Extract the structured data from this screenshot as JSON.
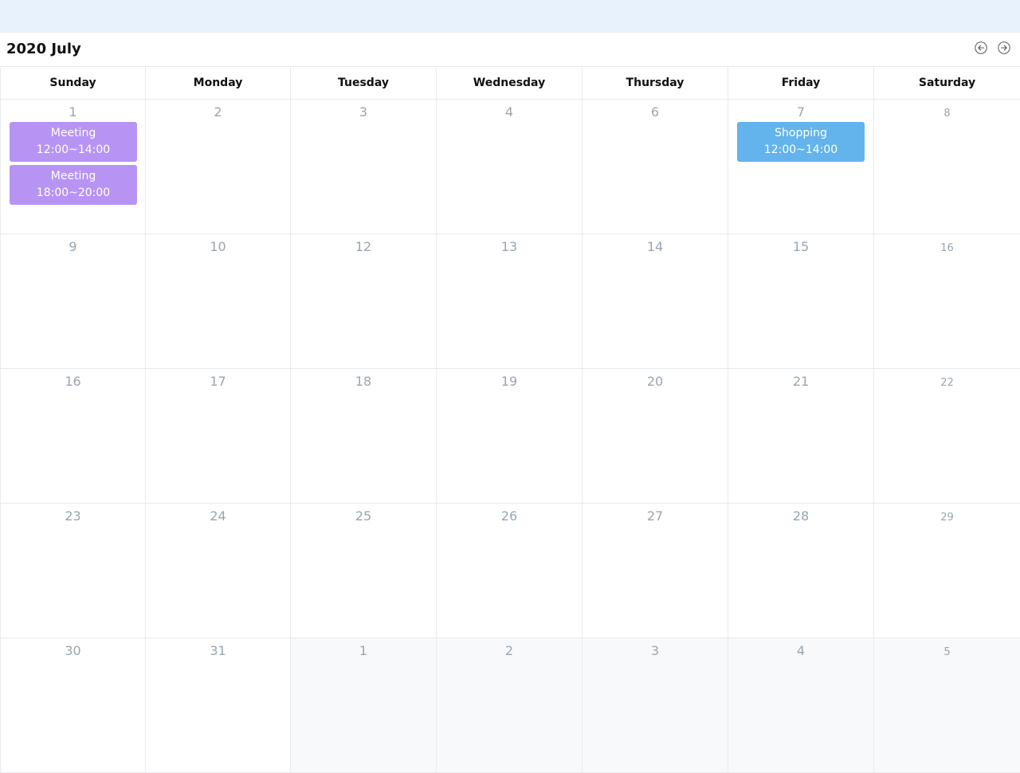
{
  "calendar": {
    "title": "2020 July",
    "prev_icon": "arrow-left-circle-icon",
    "next_icon": "arrow-right-circle-icon",
    "weekdays": [
      "Sunday",
      "Monday",
      "Tuesday",
      "Wednesday",
      "Thursday",
      "Friday",
      "Saturday"
    ],
    "weeks": [
      [
        {
          "day": "1",
          "in_month": true,
          "events": [
            {
              "name": "Meeting",
              "time": "12:00~14:00",
              "color": "#b794f4"
            },
            {
              "name": "Meeting",
              "time": "18:00~20:00",
              "color": "#b794f4"
            }
          ]
        },
        {
          "day": "2",
          "in_month": true,
          "events": []
        },
        {
          "day": "3",
          "in_month": true,
          "events": []
        },
        {
          "day": "4",
          "in_month": true,
          "events": []
        },
        {
          "day": "6",
          "in_month": true,
          "events": []
        },
        {
          "day": "7",
          "in_month": true,
          "events": [
            {
              "name": "Shopping",
              "time": "12:00~14:00",
              "color": "#63b3ed"
            }
          ]
        },
        {
          "day": "8",
          "in_month": true,
          "events": []
        }
      ],
      [
        {
          "day": "9",
          "in_month": true,
          "events": []
        },
        {
          "day": "10",
          "in_month": true,
          "events": []
        },
        {
          "day": "12",
          "in_month": true,
          "events": []
        },
        {
          "day": "13",
          "in_month": true,
          "events": []
        },
        {
          "day": "14",
          "in_month": true,
          "events": []
        },
        {
          "day": "15",
          "in_month": true,
          "events": []
        },
        {
          "day": "16",
          "in_month": true,
          "events": []
        }
      ],
      [
        {
          "day": "16",
          "in_month": true,
          "events": []
        },
        {
          "day": "17",
          "in_month": true,
          "events": []
        },
        {
          "day": "18",
          "in_month": true,
          "events": []
        },
        {
          "day": "19",
          "in_month": true,
          "events": []
        },
        {
          "day": "20",
          "in_month": true,
          "events": []
        },
        {
          "day": "21",
          "in_month": true,
          "events": []
        },
        {
          "day": "22",
          "in_month": true,
          "events": []
        }
      ],
      [
        {
          "day": "23",
          "in_month": true,
          "events": []
        },
        {
          "day": "24",
          "in_month": true,
          "events": []
        },
        {
          "day": "25",
          "in_month": true,
          "events": []
        },
        {
          "day": "26",
          "in_month": true,
          "events": []
        },
        {
          "day": "27",
          "in_month": true,
          "events": []
        },
        {
          "day": "28",
          "in_month": true,
          "events": []
        },
        {
          "day": "29",
          "in_month": true,
          "events": []
        }
      ],
      [
        {
          "day": "30",
          "in_month": true,
          "events": []
        },
        {
          "day": "31",
          "in_month": true,
          "events": []
        },
        {
          "day": "1",
          "in_month": false,
          "events": []
        },
        {
          "day": "2",
          "in_month": false,
          "events": []
        },
        {
          "day": "3",
          "in_month": false,
          "events": []
        },
        {
          "day": "4",
          "in_month": false,
          "events": []
        },
        {
          "day": "5",
          "in_month": false,
          "events": []
        }
      ]
    ]
  }
}
